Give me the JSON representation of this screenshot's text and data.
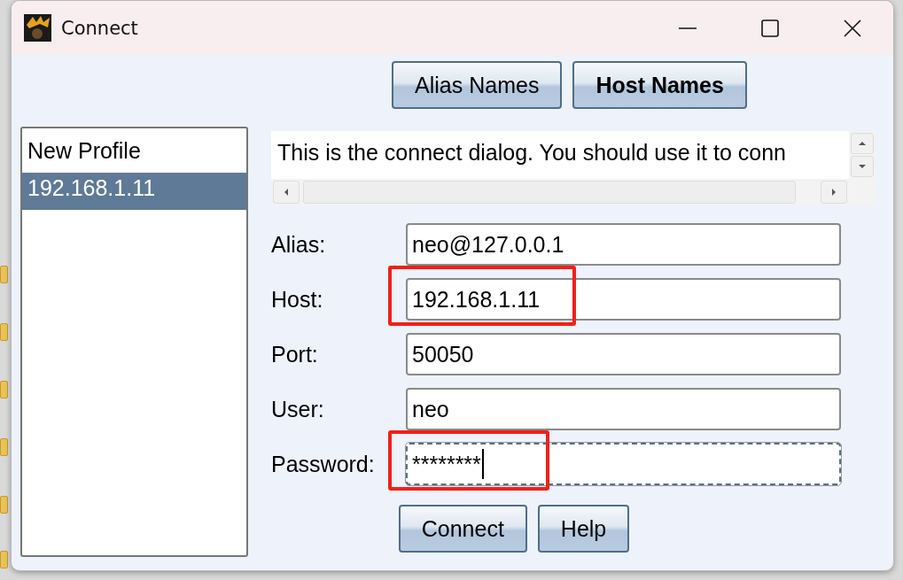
{
  "window": {
    "title": "Connect"
  },
  "tabs": [
    {
      "label": "Alias Names",
      "selected": false
    },
    {
      "label": "Host Names",
      "selected": true
    }
  ],
  "profiles": [
    {
      "label": "New Profile",
      "selected": false
    },
    {
      "label": "192.168.1.11",
      "selected": true
    }
  ],
  "description": "This is the connect dialog. You should use it to conn",
  "fields": [
    {
      "label": "Alias:",
      "value": "neo@127.0.0.1",
      "highlighted": false,
      "focused": false
    },
    {
      "label": "Host:",
      "value": "192.168.1.11",
      "highlighted": true,
      "focused": false
    },
    {
      "label": "Port:",
      "value": "50050",
      "highlighted": false,
      "focused": false
    },
    {
      "label": "User:",
      "value": "neo",
      "highlighted": false,
      "focused": false
    },
    {
      "label": "Password:",
      "value": "********",
      "highlighted": true,
      "focused": true
    }
  ],
  "buttons": [
    "Connect",
    "Help"
  ]
}
